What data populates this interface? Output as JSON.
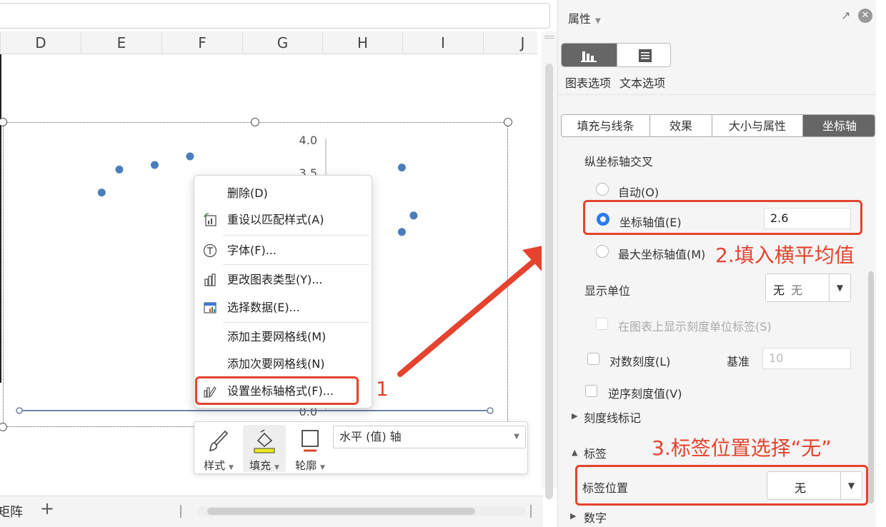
{
  "sheet": {
    "columns": [
      "D",
      "E",
      "F",
      "G",
      "H",
      "I",
      "J"
    ],
    "tab_label": "矩阵",
    "add_sheet": "+"
  },
  "chart_data": {
    "type": "scatter",
    "y_ticks": [
      "4.0",
      "3.5",
      "0.0"
    ],
    "points": [
      {
        "x": 0.85,
        "y": 3.55
      },
      {
        "x": 1.15,
        "y": 3.62
      },
      {
        "x": 1.45,
        "y": 3.75
      },
      {
        "x": 0.7,
        "y": 3.2
      },
      {
        "x": 2.8,
        "y": 2.9
      },
      {
        "x": 3.25,
        "y": 3.58
      },
      {
        "x": 3.35,
        "y": 2.85
      },
      {
        "x": 3.25,
        "y": 2.6
      }
    ]
  },
  "context_menu": {
    "items": [
      {
        "label": "删除(D)",
        "icon": ""
      },
      {
        "label": "重设以匹配样式(A)",
        "icon": "reset-style-icon"
      },
      {
        "label": "字体(F)...",
        "icon": "font-icon"
      },
      {
        "label": "更改图表类型(Y)...",
        "icon": "chart-type-icon"
      },
      {
        "label": "选择数据(E)...",
        "icon": "select-data-icon"
      },
      {
        "label": "添加主要网格线(M)",
        "icon": ""
      },
      {
        "label": "添加次要网格线(N)",
        "icon": ""
      },
      {
        "label": "设置坐标轴格式(F)...",
        "icon": "axis-format-icon"
      }
    ]
  },
  "mini_toolbar": {
    "style_label": "样式",
    "fill_label": "填充",
    "outline_label": "轮廓",
    "element_select": "水平 (值) 轴"
  },
  "annotations": {
    "step1": "1",
    "step2": "2.填入横平均值",
    "step3": "3.标签位置选择“无”",
    "color": "#e5432d"
  },
  "panel": {
    "title": "属性",
    "chart_options": "图表选项",
    "text_options": "文本选项",
    "tabs": [
      "填充与线条",
      "效果",
      "大小与属性",
      "坐标轴"
    ],
    "cross_title": "纵坐标轴交叉",
    "auto": "自动(O)",
    "axis_value": "坐标轴值(E)",
    "axis_value_input": "2.6",
    "max_axis_value": "最大坐标轴值(M)",
    "display_unit": "显示单位",
    "display_unit_value": "无",
    "display_unit_value2": "无",
    "show_unit_label": "在图表上显示刻度单位标签(S)",
    "log_scale": "对数刻度(L)",
    "base_label": "基准",
    "base_value": "10",
    "reverse": "逆序刻度值(V)",
    "tick_marks": "刻度线标记",
    "labels_section": "标签",
    "label_position": "标签位置",
    "label_position_value": "无",
    "numbers_section": "数字",
    "accent_color": "#2b7bf0"
  }
}
